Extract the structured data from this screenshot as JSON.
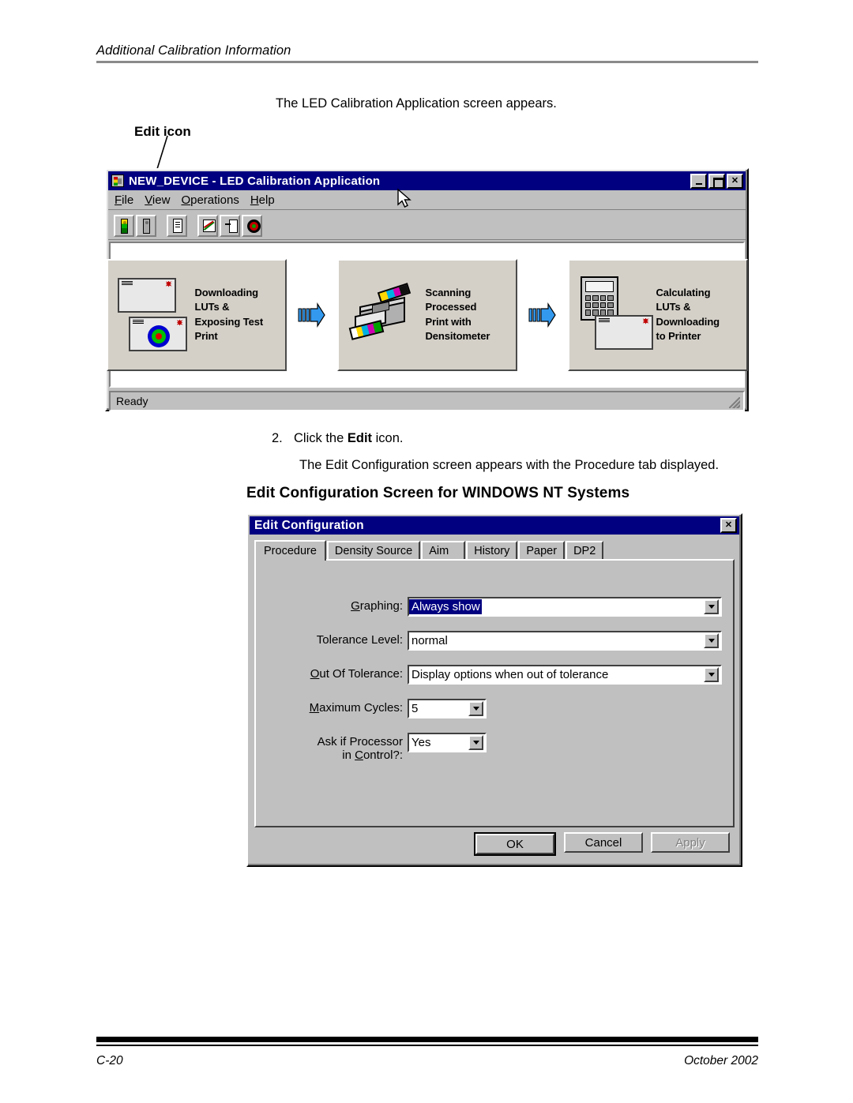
{
  "page": {
    "running_header": "Additional Calibration Information",
    "footer_left": "C-20",
    "footer_right": "October 2002"
  },
  "narrative": {
    "intro": "The LED Calibration Application screen appears.",
    "callout_label": "Edit icon",
    "step2_number": "2.",
    "step2_text_pre": "Click the ",
    "step2_text_bold": "Edit",
    "step2_text_post": " icon.",
    "step2_result": "The Edit Configuration screen appears with the Procedure tab displayed.",
    "section_title": "Edit Configuration Screen for WINDOWS NT Systems"
  },
  "app_window": {
    "title": "NEW_DEVICE - LED Calibration Application",
    "window_icon": "led-device-icon",
    "window_buttons": [
      {
        "name": "minimize-button",
        "glyph": "_"
      },
      {
        "name": "maximize-button",
        "glyph": "□"
      },
      {
        "name": "close-button",
        "glyph": "✕"
      }
    ],
    "menus": [
      {
        "label": "File",
        "accel": "F"
      },
      {
        "label": "View",
        "accel": "V"
      },
      {
        "label": "Operations",
        "accel": "O"
      },
      {
        "label": "Help",
        "accel": "H"
      }
    ],
    "toolbar": [
      {
        "name": "traffic-light-green-icon",
        "glyph": "gl-traffic-on"
      },
      {
        "name": "traffic-light-gray-icon",
        "glyph": "gl-traffic-off"
      },
      {
        "name": "edit-document-icon",
        "glyph": "gl-doc"
      },
      {
        "name": "graph-icon",
        "glyph": "gl-graph"
      },
      {
        "name": "download-document-icon",
        "glyph": "gl-dl"
      },
      {
        "name": "target-icon",
        "glyph": "gl-target"
      }
    ],
    "flow_steps": [
      {
        "label": "Downloading\nLUTs &\nExposing Test\nPrint",
        "art": "windows-with-bullseye"
      },
      {
        "label": "Scanning\nProcessed\nPrint with\nDensitometer",
        "art": "densitometer-scanner"
      },
      {
        "label": "Calculating\nLUTs &\nDownloading\nto Printer",
        "art": "calculator-and-window"
      }
    ],
    "status_text": "Ready"
  },
  "dialog": {
    "title": "Edit Configuration",
    "close_glyph": "✕",
    "tabs": [
      {
        "label": "Procedure",
        "active": true
      },
      {
        "label": "Density Source",
        "active": false
      },
      {
        "label": "Aim",
        "active": false
      },
      {
        "label": "History",
        "active": false
      },
      {
        "label": "Paper",
        "active": false
      },
      {
        "label": "DP2",
        "active": false
      }
    ],
    "fields": [
      {
        "label": "Graphing:",
        "accel": "G",
        "value": "Always show",
        "selected": true,
        "width": "wide"
      },
      {
        "label": "Tolerance Level:",
        "accel": "",
        "value": "normal",
        "selected": false,
        "width": "wide"
      },
      {
        "label": "Out Of Tolerance:",
        "accel": "O",
        "value": "Display options when out of tolerance",
        "selected": false,
        "width": "wide"
      },
      {
        "label": "Maximum Cycles:",
        "accel": "M",
        "value": "5",
        "selected": false,
        "width": "narrow"
      },
      {
        "label": "Ask if Processor\nin Control?:",
        "accel": "C",
        "value": "Yes",
        "selected": false,
        "width": "narrow"
      }
    ],
    "buttons": [
      {
        "label": "OK",
        "state": "default"
      },
      {
        "label": "Cancel",
        "state": "normal"
      },
      {
        "label": "Apply",
        "state": "disabled"
      }
    ]
  },
  "colors": {
    "titlebar": "#000080",
    "face": "#c0c0c0",
    "highlight": "#000080",
    "arrow_blue": "#3399ee"
  }
}
